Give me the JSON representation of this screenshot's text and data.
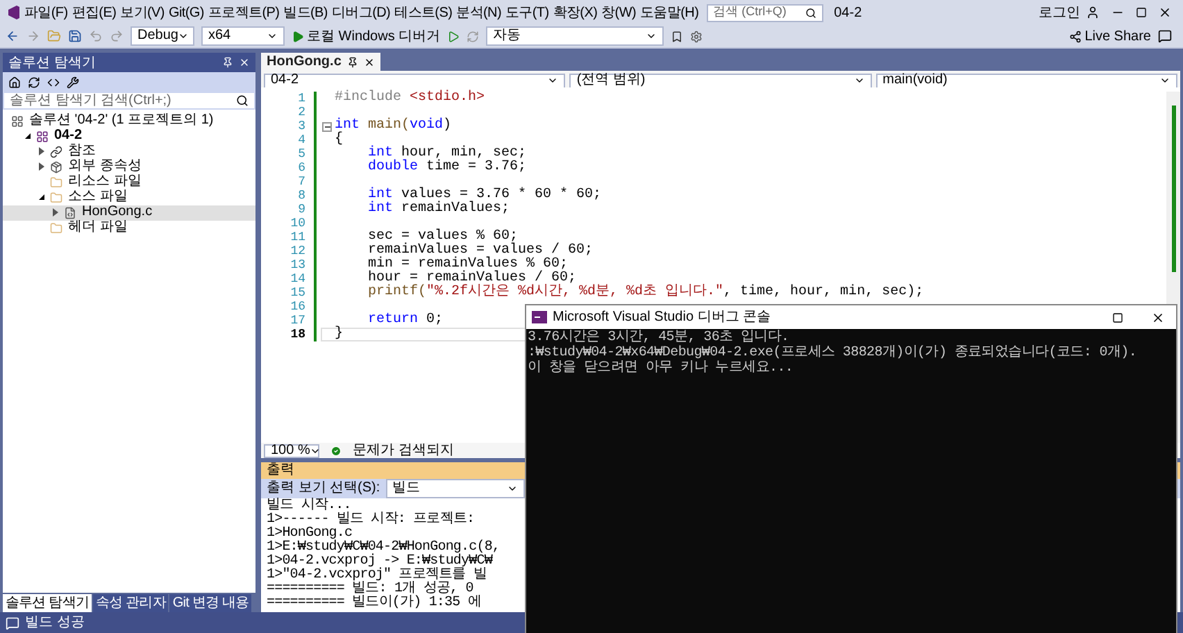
{
  "title_bar": {
    "menu": [
      "파일(F)",
      "편집(E)",
      "보기(V)",
      "Git(G)",
      "프로젝트(P)",
      "빌드(B)",
      "디버그(D)",
      "테스트(S)",
      "분석(N)",
      "도구(T)",
      "확장(X)",
      "창(W)",
      "도움말(H)"
    ],
    "search": {
      "placeholder": "검색 (Ctrl+Q)"
    },
    "solution_name": "04-2",
    "sign_in": "로그인"
  },
  "toolbar": {
    "configuration": "Debug",
    "platform": "x64",
    "debugger": "로컬 Windows 디버거",
    "stack_frame": "자동",
    "live_share": "Live Share"
  },
  "solution_explorer": {
    "title": "솔루션 탐색기",
    "search": {
      "placeholder": "솔루션 탐색기 검색(Ctrl+;)"
    },
    "tree": [
      {
        "label": "솔루션 '04-2' (1 프로젝트의 1)",
        "kind": "solution",
        "selected": false,
        "children": [
          {
            "label": "04-2",
            "kind": "project",
            "expanded": true,
            "selected": false,
            "children": [
              {
                "label": "참조",
                "kind": "reference",
                "expanded": false,
                "selected": false
              },
              {
                "label": "외부 종속성",
                "kind": "dependencies",
                "expanded": false,
                "selected": false
              },
              {
                "label": "리소스 파일",
                "kind": "folder",
                "expanded": false,
                "selected": false
              },
              {
                "label": "소스 파일",
                "kind": "folder",
                "expanded": true,
                "selected": false,
                "children": [
                  {
                    "label": "HonGong.c",
                    "kind": "file",
                    "expanded": false,
                    "selected": true
                  }
                ]
              },
              {
                "label": "헤더 파일",
                "kind": "folder",
                "expanded": false,
                "selected": false
              }
            ]
          }
        ]
      }
    ],
    "tabs": [
      {
        "label": "솔루션 탐색기",
        "selected": true
      },
      {
        "label": "속성 관리자",
        "selected": false
      },
      {
        "label": "Git 변경 내용",
        "selected": false
      }
    ]
  },
  "editor": {
    "tab": {
      "label": "HonGong.c",
      "selected": true
    },
    "nav": [
      "04-2",
      "(전역 범위)",
      "main(void)"
    ],
    "lines": [
      {
        "number": "1",
        "indented": false,
        "fold": false,
        "current": false,
        "tokens": [
          {
            "text": "#include ",
            "kind": "preproc"
          },
          {
            "text": "<stdio.h>",
            "kind": "string"
          }
        ]
      },
      {
        "number": "2",
        "fold": false,
        "current": false
      },
      {
        "number": "3",
        "indented": false,
        "fold": true,
        "current": false,
        "tokens": [
          {
            "text": "int",
            "kind": "keyword"
          },
          {
            "text": " main(",
            "kind": "function"
          },
          {
            "text": "void",
            "kind": "keyword"
          },
          {
            "text": ")",
            "kind": "plain"
          }
        ]
      },
      {
        "number": "4",
        "indented": false,
        "fold": false,
        "current": false,
        "tokens": [
          {
            "text": "{",
            "kind": "plain"
          }
        ]
      },
      {
        "number": "5",
        "indented": true,
        "fold": false,
        "current": false,
        "tokens": [
          {
            "text": "int",
            "kind": "keyword"
          },
          {
            "text": " hour, min, sec;",
            "kind": "plain"
          }
        ]
      },
      {
        "number": "6",
        "indented": true,
        "fold": false,
        "current": false,
        "tokens": [
          {
            "text": "double",
            "kind": "keyword"
          },
          {
            "text": " time = 3.76;",
            "kind": "plain"
          }
        ]
      },
      {
        "number": "7",
        "fold": false,
        "current": false
      },
      {
        "number": "8",
        "indented": true,
        "fold": false,
        "current": false,
        "tokens": [
          {
            "text": "int",
            "kind": "keyword"
          },
          {
            "text": " values = 3.76 * 60 * 60;",
            "kind": "plain"
          }
        ]
      },
      {
        "number": "9",
        "indented": true,
        "fold": false,
        "current": false,
        "tokens": [
          {
            "text": "int",
            "kind": "keyword"
          },
          {
            "text": " remainValues;",
            "kind": "plain"
          }
        ]
      },
      {
        "number": "10",
        "fold": false,
        "current": false
      },
      {
        "number": "11",
        "indented": true,
        "fold": false,
        "current": false,
        "tokens": [
          {
            "text": "sec = values % 60;",
            "kind": "plain"
          }
        ]
      },
      {
        "number": "12",
        "indented": true,
        "fold": false,
        "current": false,
        "tokens": [
          {
            "text": "remainValues = values / 60;",
            "kind": "plain"
          }
        ]
      },
      {
        "number": "13",
        "indented": true,
        "fold": false,
        "current": false,
        "tokens": [
          {
            "text": "min = remainValues % 60;",
            "kind": "plain"
          }
        ]
      },
      {
        "number": "14",
        "indented": true,
        "fold": false,
        "current": false,
        "tokens": [
          {
            "text": "hour = remainValues / 60;",
            "kind": "plain"
          }
        ]
      },
      {
        "number": "15",
        "indented": true,
        "fold": false,
        "current": false,
        "tokens": [
          {
            "text": "printf(",
            "kind": "function"
          },
          {
            "text": "\"%.2f시간은 %d시간, %d분, %d초 입니다.\"",
            "kind": "string"
          },
          {
            "text": ", time, hour, min, sec);",
            "kind": "plain"
          }
        ]
      },
      {
        "number": "16",
        "fold": false,
        "current": false
      },
      {
        "number": "17",
        "indented": true,
        "fold": false,
        "current": false,
        "tokens": [
          {
            "text": "return",
            "kind": "keyword"
          },
          {
            "text": " 0;",
            "kind": "plain"
          }
        ]
      },
      {
        "number": "18",
        "indented": false,
        "fold": false,
        "current": true,
        "tokens": [
          {
            "text": "}",
            "kind": "plain"
          }
        ]
      }
    ],
    "zoom": "100 %",
    "issues": "문제가 검색되지"
  },
  "output": {
    "title": "출력",
    "source_label": "출력 보기 선택(S):",
    "source": "빌드",
    "lines": [
      "빌드 시작...",
      "1>------ 빌드 시작: 프로젝트:",
      "1>HonGong.c",
      "1>E:₩study₩C₩04-2₩HonGong.c(8,",
      "1>04-2.vcxproj -> E:₩study₩C₩",
      "1>\"04-2.vcxproj\" 프로젝트를 빌",
      "========== 빌드: 1개 성공, 0",
      "========== 빌드이(가) 1:35 에"
    ]
  },
  "console": {
    "title": "Microsoft Visual Studio 디버그 콘솔",
    "lines": [
      "3.76시간은 3시간, 45분, 36초 입니다.",
      ":₩study₩04-2₩x64₩Debug₩04-2.exe(프로세스 38828개)이(가) 종료되었습니다(코드: 0개).",
      "이 창을 닫으려면 아무 키나 누르세요..."
    ]
  },
  "status_bar": {
    "text": "빌드 성공"
  }
}
